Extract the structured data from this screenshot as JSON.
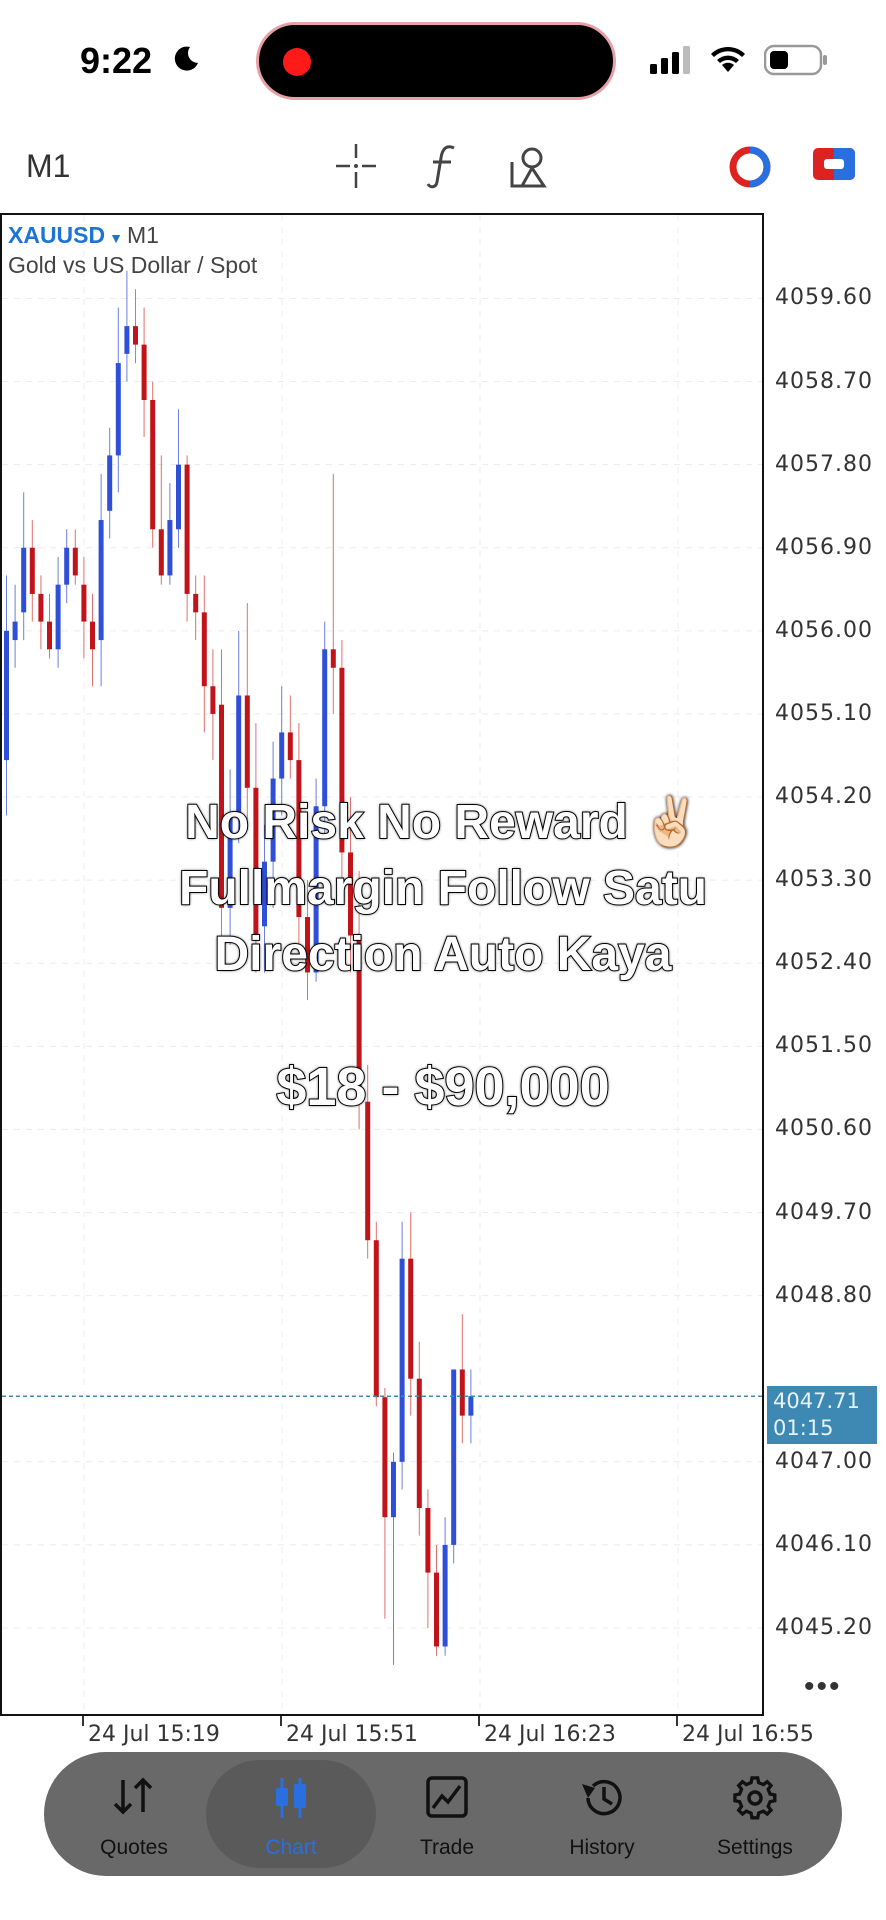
{
  "status": {
    "time": "9:22"
  },
  "toolbar": {
    "timeframe": "M1"
  },
  "chart_info": {
    "symbol": "XAUUSD",
    "timeframe": "M1",
    "description": "Gold vs US Dollar / Spot"
  },
  "price_axis": [
    "4059.60",
    "4058.70",
    "4057.80",
    "4056.90",
    "4056.00",
    "4055.10",
    "4054.20",
    "4053.30",
    "4052.40",
    "4051.50",
    "4050.60",
    "4049.70",
    "4048.80",
    "4047.00",
    "4046.10",
    "4045.20"
  ],
  "current": {
    "price": "4047.71",
    "countdown": "01:15"
  },
  "time_axis": [
    "24 Jul 15:19",
    "24 Jul 15:51",
    "24 Jul 16:23",
    "24 Jul 16:55"
  ],
  "overlay": {
    "line1": "No Risk No Reward ✌🏻",
    "line2": "Fullmargin Follow Satu",
    "line3": "Direction Auto Kaya",
    "amount": "$18 - $90,000"
  },
  "tabs": [
    {
      "label": "Quotes",
      "icon": "quotes-icon"
    },
    {
      "label": "Chart",
      "icon": "chart-icon",
      "active": true
    },
    {
      "label": "Trade",
      "icon": "trade-icon"
    },
    {
      "label": "History",
      "icon": "history-icon"
    },
    {
      "label": "Settings",
      "icon": "settings-icon"
    }
  ],
  "colors": {
    "bull": "#2f4fd8",
    "bear": "#c0141a",
    "accent": "#1e73d6",
    "current_price_bg": "#3d89b3"
  },
  "chart_data": {
    "type": "candlestick",
    "title": "XAUUSD M1",
    "ylim": [
      4044.6,
      4060.4
    ],
    "x": [
      "24 Jul 15:19",
      "24 Jul 15:51",
      "24 Jul 16:23",
      "24 Jul 16:55"
    ],
    "candles": [
      {
        "o": 4054.6,
        "h": 4056.6,
        "l": 4054.0,
        "c": 4056.0
      },
      {
        "o": 4055.9,
        "h": 4056.5,
        "l": 4055.6,
        "c": 4056.1
      },
      {
        "o": 4056.2,
        "h": 4057.5,
        "l": 4055.9,
        "c": 4056.9
      },
      {
        "o": 4056.9,
        "h": 4057.2,
        "l": 4056.1,
        "c": 4056.4
      },
      {
        "o": 4056.4,
        "h": 4056.6,
        "l": 4055.8,
        "c": 4056.1
      },
      {
        "o": 4056.1,
        "h": 4056.4,
        "l": 4055.7,
        "c": 4055.8
      },
      {
        "o": 4055.8,
        "h": 4056.8,
        "l": 4055.6,
        "c": 4056.5
      },
      {
        "o": 4056.5,
        "h": 4057.1,
        "l": 4056.3,
        "c": 4056.9
      },
      {
        "o": 4056.9,
        "h": 4057.1,
        "l": 4056.5,
        "c": 4056.6
      },
      {
        "o": 4056.5,
        "h": 4056.8,
        "l": 4055.7,
        "c": 4056.1
      },
      {
        "o": 4056.1,
        "h": 4056.4,
        "l": 4055.4,
        "c": 4055.8
      },
      {
        "o": 4055.9,
        "h": 4057.7,
        "l": 4055.4,
        "c": 4057.2
      },
      {
        "o": 4057.3,
        "h": 4058.2,
        "l": 4057.0,
        "c": 4057.9
      },
      {
        "o": 4057.9,
        "h": 4059.5,
        "l": 4057.5,
        "c": 4058.9
      },
      {
        "o": 4059.0,
        "h": 4059.9,
        "l": 4058.7,
        "c": 4059.3
      },
      {
        "o": 4059.3,
        "h": 4059.7,
        "l": 4058.9,
        "c": 4059.1
      },
      {
        "o": 4059.1,
        "h": 4059.5,
        "l": 4058.1,
        "c": 4058.5
      },
      {
        "o": 4058.5,
        "h": 4058.7,
        "l": 4056.9,
        "c": 4057.1
      },
      {
        "o": 4057.1,
        "h": 4057.9,
        "l": 4056.5,
        "c": 4056.6
      },
      {
        "o": 4056.6,
        "h": 4057.6,
        "l": 4056.5,
        "c": 4057.2
      },
      {
        "o": 4057.1,
        "h": 4058.4,
        "l": 4056.9,
        "c": 4057.8
      },
      {
        "o": 4057.8,
        "h": 4057.9,
        "l": 4056.1,
        "c": 4056.4
      },
      {
        "o": 4056.4,
        "h": 4056.6,
        "l": 4055.9,
        "c": 4056.2
      },
      {
        "o": 4056.2,
        "h": 4056.6,
        "l": 4054.9,
        "c": 4055.4
      },
      {
        "o": 4055.4,
        "h": 4055.8,
        "l": 4054.6,
        "c": 4055.1
      },
      {
        "o": 4055.2,
        "h": 4055.8,
        "l": 4052.5,
        "c": 4053.0
      },
      {
        "o": 4053.0,
        "h": 4054.5,
        "l": 4052.6,
        "c": 4054.0
      },
      {
        "o": 4054.0,
        "h": 4056.0,
        "l": 4053.7,
        "c": 4055.3
      },
      {
        "o": 4055.3,
        "h": 4056.3,
        "l": 4053.9,
        "c": 4054.3
      },
      {
        "o": 4054.3,
        "h": 4055.0,
        "l": 4052.3,
        "c": 4052.7
      },
      {
        "o": 4052.8,
        "h": 4053.9,
        "l": 4052.3,
        "c": 4053.5
      },
      {
        "o": 4053.5,
        "h": 4054.8,
        "l": 4053.0,
        "c": 4054.4
      },
      {
        "o": 4054.4,
        "h": 4055.4,
        "l": 4054.0,
        "c": 4054.9
      },
      {
        "o": 4054.9,
        "h": 4055.3,
        "l": 4054.4,
        "c": 4054.6
      },
      {
        "o": 4054.6,
        "h": 4055.0,
        "l": 4052.6,
        "c": 4052.9
      },
      {
        "o": 4052.9,
        "h": 4053.3,
        "l": 4052.0,
        "c": 4052.3
      },
      {
        "o": 4052.3,
        "h": 4054.4,
        "l": 4052.2,
        "c": 4054.1
      },
      {
        "o": 4054.1,
        "h": 4056.1,
        "l": 4053.8,
        "c": 4055.8
      },
      {
        "o": 4055.8,
        "h": 4057.7,
        "l": 4055.1,
        "c": 4055.6
      },
      {
        "o": 4055.6,
        "h": 4055.9,
        "l": 4053.1,
        "c": 4053.6
      },
      {
        "o": 4053.6,
        "h": 4054.2,
        "l": 4052.3,
        "c": 4052.7
      },
      {
        "o": 4052.7,
        "h": 4053.4,
        "l": 4050.6,
        "c": 4050.9
      },
      {
        "o": 4050.9,
        "h": 4051.3,
        "l": 4049.2,
        "c": 4049.4
      },
      {
        "o": 4049.4,
        "h": 4049.6,
        "l": 4047.6,
        "c": 4047.7
      },
      {
        "o": 4047.7,
        "h": 4047.8,
        "l": 4045.3,
        "c": 4046.4
      },
      {
        "o": 4046.4,
        "h": 4047.1,
        "l": 4044.8,
        "c": 4047.0
      },
      {
        "o": 4047.0,
        "h": 4049.6,
        "l": 4046.7,
        "c": 4049.2
      },
      {
        "o": 4049.2,
        "h": 4049.7,
        "l": 4047.5,
        "c": 4047.9
      },
      {
        "o": 4047.9,
        "h": 4048.3,
        "l": 4046.2,
        "c": 4046.5
      },
      {
        "o": 4046.5,
        "h": 4046.7,
        "l": 4045.2,
        "c": 4045.8
      },
      {
        "o": 4045.8,
        "h": 4046.1,
        "l": 4044.9,
        "c": 4045.0
      },
      {
        "o": 4045.0,
        "h": 4046.4,
        "l": 4044.9,
        "c": 4046.1
      },
      {
        "o": 4046.1,
        "h": 4048.0,
        "l": 4045.9,
        "c": 4048.0
      },
      {
        "o": 4048.0,
        "h": 4048.6,
        "l": 4047.2,
        "c": 4047.5
      },
      {
        "o": 4047.5,
        "h": 4048.0,
        "l": 4047.2,
        "c": 4047.71
      }
    ]
  }
}
